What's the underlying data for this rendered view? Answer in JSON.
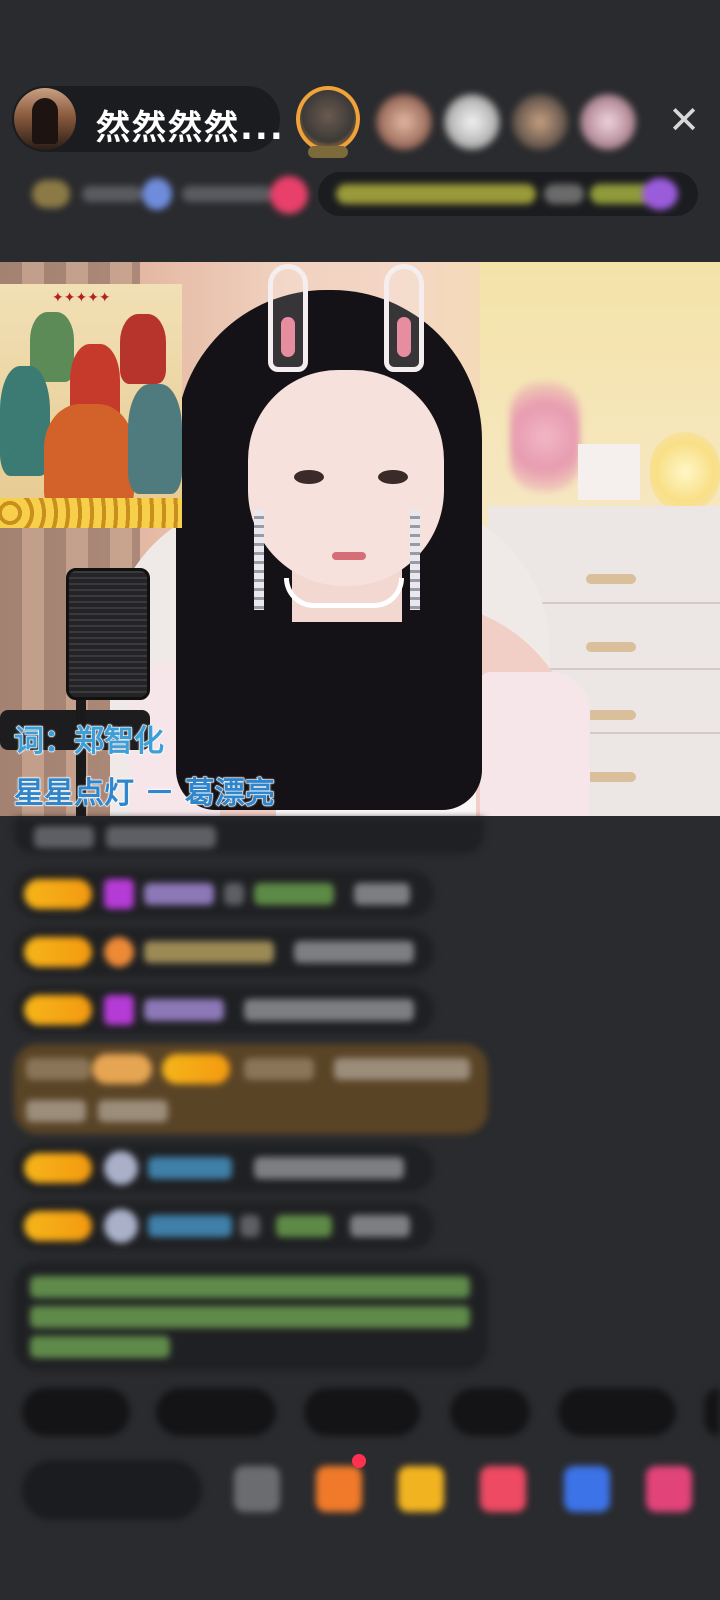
{
  "header": {
    "host_name": "然然然然...",
    "close_label": "✕"
  },
  "colors": {
    "level_badge": "#f6b519",
    "lyric_blue": "#3e9ed8",
    "chat_bg": "#1f2023",
    "page_bg": "#2a2b2e"
  },
  "icons": {
    "close": "close-icon",
    "gift_purple": "diamond-icon",
    "gift_orange": "fan-club-icon"
  },
  "video": {
    "lyrics": {
      "line1": "词：郑智化",
      "line2": "星星点灯 － 葛漂亮"
    }
  }
}
